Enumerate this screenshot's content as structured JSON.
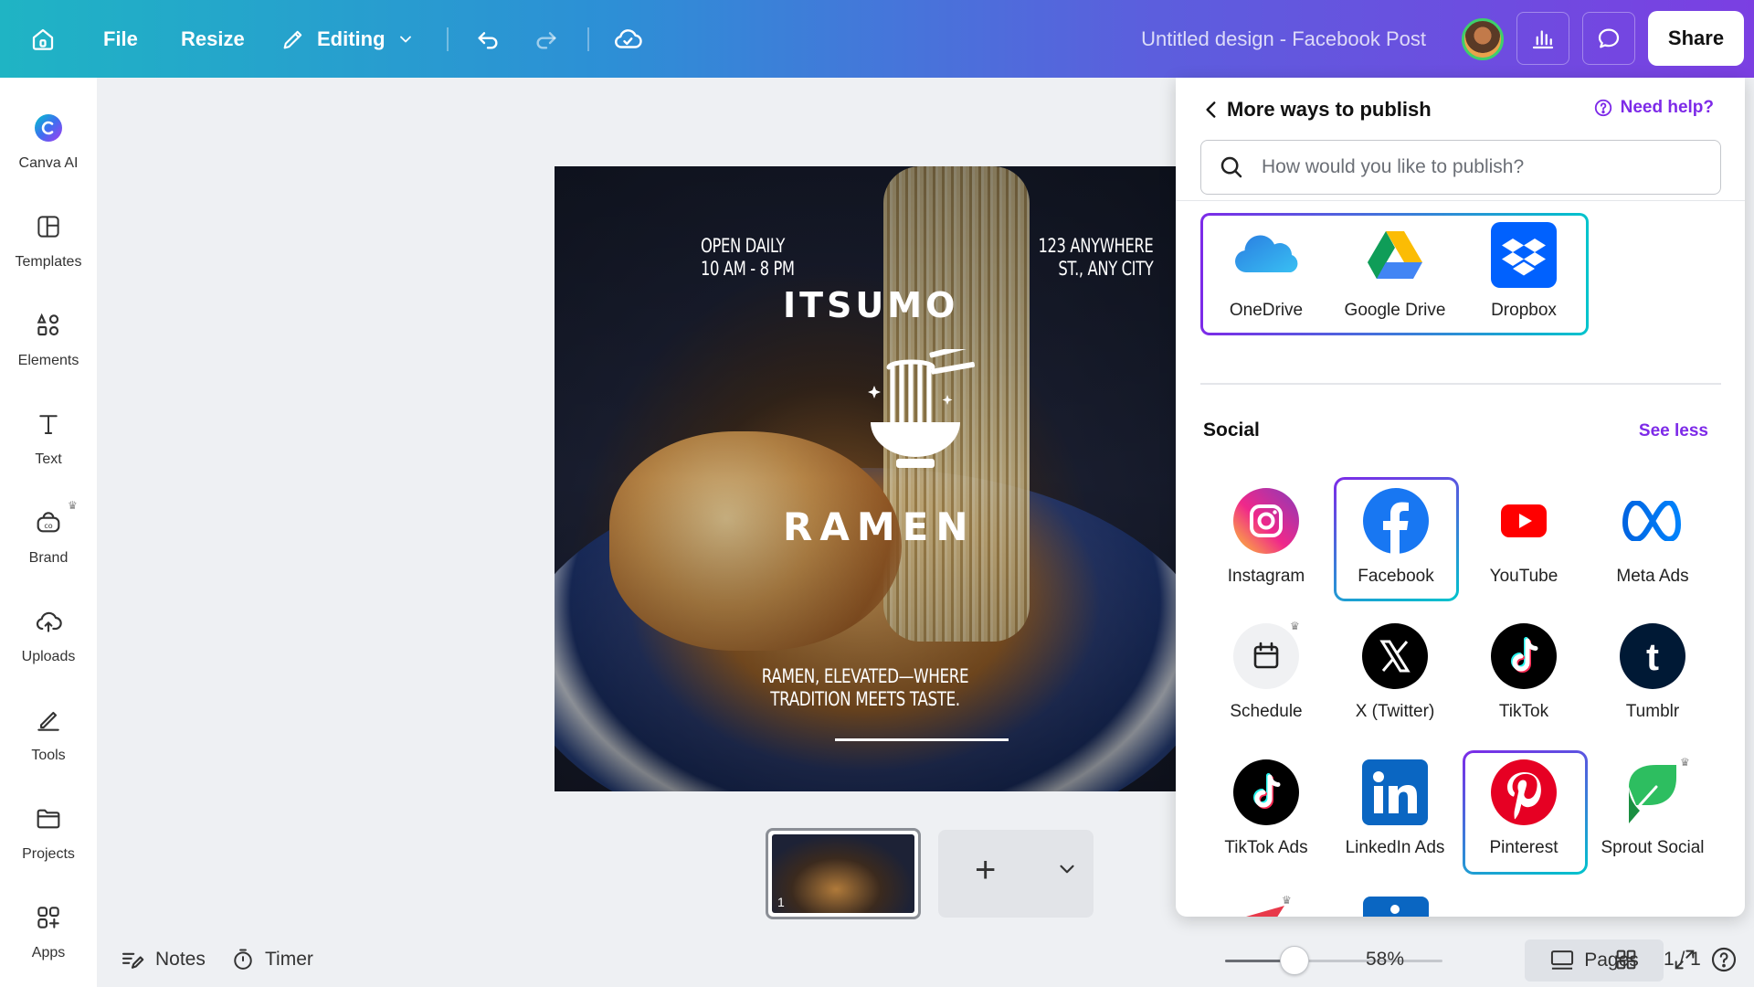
{
  "topbar": {
    "file": "File",
    "resize": "Resize",
    "editing": "Editing",
    "doc_title": "Untitled design - Facebook Post",
    "share": "Share"
  },
  "sidebar": {
    "items": [
      {
        "label": "Canva AI",
        "icon": "canva-ai-icon"
      },
      {
        "label": "Templates",
        "icon": "templates-icon"
      },
      {
        "label": "Elements",
        "icon": "elements-icon"
      },
      {
        "label": "Text",
        "icon": "text-icon"
      },
      {
        "label": "Brand",
        "icon": "brand-icon",
        "premium": true
      },
      {
        "label": "Uploads",
        "icon": "uploads-icon"
      },
      {
        "label": "Tools",
        "icon": "tools-icon"
      },
      {
        "label": "Projects",
        "icon": "projects-icon"
      },
      {
        "label": "Apps",
        "icon": "apps-icon"
      }
    ]
  },
  "design": {
    "hours": [
      "OPEN DAILY",
      "10 AM - 8 PM"
    ],
    "address": [
      "123 ANYWHERE",
      "ST., ANY CITY"
    ],
    "brand_top": "ITSUMO",
    "brand_bottom": "RAMEN",
    "tagline": [
      "RAMEN, ELEVATED—WHERE",
      "TRADITION MEETS TASTE."
    ]
  },
  "pages": {
    "thumb_number": "1"
  },
  "bottombar": {
    "notes": "Notes",
    "timer": "Timer",
    "zoom": "58%",
    "zoom_level": 0.58,
    "pages": "Pages",
    "page_count": "1 / 1"
  },
  "publish_panel": {
    "title": "More ways to publish",
    "help": "Need help?",
    "search_placeholder": "How would you like to publish?",
    "storage": [
      {
        "label": "OneDrive",
        "icon": "onedrive-icon"
      },
      {
        "label": "Google Drive",
        "icon": "google-drive-icon"
      },
      {
        "label": "Dropbox",
        "icon": "dropbox-icon"
      }
    ],
    "social_title": "Social",
    "see_less": "See less",
    "social": [
      {
        "label": "Instagram",
        "icon": "instagram-icon"
      },
      {
        "label": "Facebook",
        "icon": "facebook-icon",
        "selected": true
      },
      {
        "label": "YouTube",
        "icon": "youtube-icon"
      },
      {
        "label": "Meta Ads",
        "icon": "meta-icon"
      },
      {
        "label": "Schedule",
        "icon": "calendar-icon",
        "premium": true
      },
      {
        "label": "X (Twitter)",
        "icon": "x-icon"
      },
      {
        "label": "TikTok",
        "icon": "tiktok-icon"
      },
      {
        "label": "Tumblr",
        "icon": "tumblr-icon"
      },
      {
        "label": "TikTok Ads",
        "icon": "tiktok-icon"
      },
      {
        "label": "LinkedIn Ads",
        "icon": "linkedin-icon"
      },
      {
        "label": "Pinterest",
        "icon": "pinterest-icon",
        "selected": true
      },
      {
        "label": "Sprout Social",
        "icon": "sprout-social-icon",
        "premium": true
      }
    ]
  },
  "colors": {
    "accent": "#7d2ae8",
    "teal": "#00c4cc"
  }
}
